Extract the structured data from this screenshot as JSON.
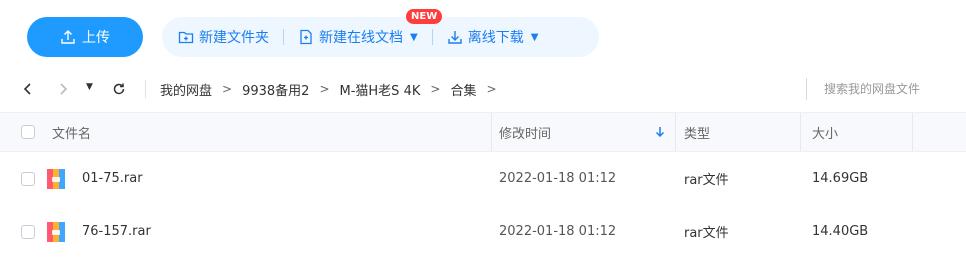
{
  "toolbar": {
    "upload_label": "上传",
    "new_folder_label": "新建文件夹",
    "new_online_doc_label": "新建在线文档",
    "new_badge": "NEW",
    "offline_download_label": "离线下载"
  },
  "breadcrumb": {
    "items": [
      "我的网盘",
      "9938备用2",
      "M-猫H老S 4K",
      "合集"
    ],
    "separator": ">"
  },
  "search": {
    "placeholder": "搜索我的网盘文件"
  },
  "table": {
    "headers": {
      "name": "文件名",
      "modified": "修改时间",
      "type": "类型",
      "size": "大小"
    },
    "sort_icon": "arrow-down-icon",
    "rows": [
      {
        "name": "01-75.rar",
        "modified": "2022-01-18 01:12",
        "type": "rar文件",
        "size": "14.69GB",
        "icon": "rar-archive-icon"
      },
      {
        "name": "76-157.rar",
        "modified": "2022-01-18 01:12",
        "type": "rar文件",
        "size": "14.40GB",
        "icon": "rar-archive-icon"
      }
    ]
  },
  "colors": {
    "accent": "#1f9bff",
    "accent_light": "#eef6ff",
    "accent_text": "#1b7ff0",
    "badge": "#ff3d3d"
  }
}
